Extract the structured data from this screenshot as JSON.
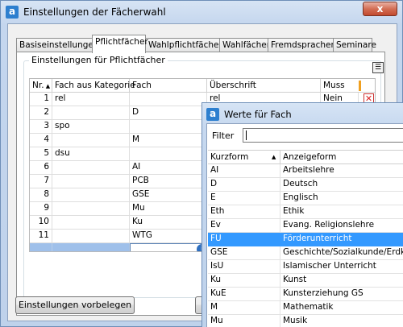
{
  "window": {
    "title": "Einstellungen der Fächerwahl",
    "close_label": "x"
  },
  "tabs": [
    {
      "label": "Basiseinstellungen"
    },
    {
      "label": "Pflichtfächer"
    },
    {
      "label": "Wahlpflichtfächer"
    },
    {
      "label": "Wahlfächer"
    },
    {
      "label": "Fremdsprachen"
    },
    {
      "label": "Seminare"
    }
  ],
  "group": {
    "label": "Einstellungen für Pflichtfächer"
  },
  "table": {
    "headers": {
      "nr": "Nr.",
      "kategorie": "Fach aus Kategorie",
      "fach": "Fach",
      "ueberschrift": "Überschrift",
      "muss": "Muss"
    },
    "rows": [
      {
        "nr": "1",
        "kategorie": "rel",
        "fach": "",
        "ueberschrift": "rel",
        "muss": "Nein"
      },
      {
        "nr": "2",
        "kategorie": "",
        "fach": "D",
        "ueberschrift": "",
        "muss": ""
      },
      {
        "nr": "3",
        "kategorie": "spo",
        "fach": "",
        "ueberschrift": "",
        "muss": ""
      },
      {
        "nr": "4",
        "kategorie": "",
        "fach": "M",
        "ueberschrift": "",
        "muss": ""
      },
      {
        "nr": "5",
        "kategorie": "dsu",
        "fach": "",
        "ueberschrift": "",
        "muss": ""
      },
      {
        "nr": "6",
        "kategorie": "",
        "fach": "AI",
        "ueberschrift": "",
        "muss": ""
      },
      {
        "nr": "7",
        "kategorie": "",
        "fach": "PCB",
        "ueberschrift": "",
        "muss": ""
      },
      {
        "nr": "8",
        "kategorie": "",
        "fach": "GSE",
        "ueberschrift": "",
        "muss": ""
      },
      {
        "nr": "9",
        "kategorie": "",
        "fach": "Mu",
        "ueberschrift": "",
        "muss": ""
      },
      {
        "nr": "10",
        "kategorie": "",
        "fach": "Ku",
        "ueberschrift": "",
        "muss": ""
      },
      {
        "nr": "11",
        "kategorie": "",
        "fach": "WTG",
        "ueberschrift": "",
        "muss": ""
      }
    ]
  },
  "buttons": {
    "defaults_label": "Einstellungen vorbelegen"
  },
  "popup": {
    "title": "Werte für Fach",
    "filter_label": "Filter",
    "filter_value": "",
    "headers": {
      "kurzform": "Kurzform",
      "anzeigeform": "Anzeigeform"
    },
    "rows": [
      {
        "kurz": "AI",
        "anzeige": "Arbeitslehre"
      },
      {
        "kurz": "D",
        "anzeige": "Deutsch"
      },
      {
        "kurz": "E",
        "anzeige": "Englisch"
      },
      {
        "kurz": "Eth",
        "anzeige": "Ethik"
      },
      {
        "kurz": "Ev",
        "anzeige": "Evang. Religionslehre"
      },
      {
        "kurz": "FU",
        "anzeige": "Förderunterricht"
      },
      {
        "kurz": "GSE",
        "anzeige": "Geschichte/Sozialkunde/Erdkunde"
      },
      {
        "kurz": "IsU",
        "anzeige": "Islamischer Unterricht"
      },
      {
        "kurz": "Ku",
        "anzeige": "Kunst"
      },
      {
        "kurz": "KuE",
        "anzeige": "Kunsterziehung GS"
      },
      {
        "kurz": "M",
        "anzeige": "Mathematik"
      },
      {
        "kurz": "Mu",
        "anzeige": "Musik"
      }
    ],
    "selected_row": "FU"
  },
  "icons": {
    "app": "app-icon",
    "close": "close-icon",
    "sort_ascending": "sort-ascending-icon",
    "info": "info-icon",
    "delete": "delete-icon",
    "column_chooser": "column-chooser-icon"
  },
  "colors": {
    "selection": "#3399ff",
    "new_row": "#9fc0ea",
    "accent": "#2d7fcf"
  }
}
